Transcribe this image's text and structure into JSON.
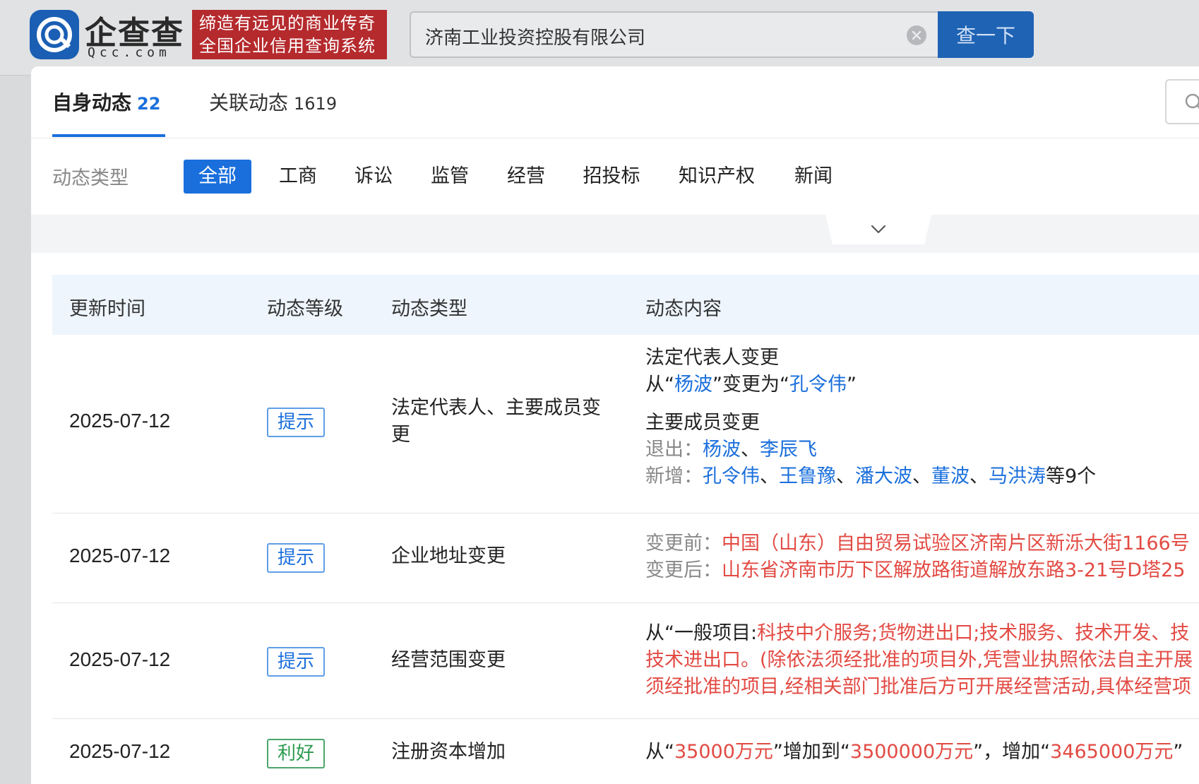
{
  "header": {
    "logo_cn": "企查查",
    "logo_en": "Qcc.com",
    "slogan_line1": "缔造有远见的商业传奇",
    "slogan_line2": "全国企业信用查询系统",
    "search_value": "济南工业投资控股有限公司",
    "search_button": "查一下"
  },
  "tabs": [
    {
      "label": "自身动态",
      "count": "22"
    },
    {
      "label": "关联动态",
      "count": "1619"
    }
  ],
  "filter": {
    "label": "动态类型",
    "chips": [
      "全部",
      "工商",
      "诉讼",
      "监管",
      "经营",
      "招投标",
      "知识产权",
      "新闻"
    ]
  },
  "table": {
    "headers": [
      "更新时间",
      "动态等级",
      "动态类型",
      "动态内容"
    ],
    "rows": [
      {
        "date": "2025-07-12",
        "level": "提示",
        "type": "法定代表人、主要成员变更",
        "content": {
          "legal_title": "法定代表人变更",
          "legal_prefix": "从“",
          "legal_from": "杨波",
          "legal_middle": "”变更为“",
          "legal_to": "孔令伟",
          "legal_suffix": "”",
          "members_title": "主要成员变更",
          "exit_label": "退出：",
          "exit_names": [
            "杨波",
            "李辰飞"
          ],
          "add_label": "新增：",
          "add_names": [
            "孔令伟",
            "王鲁豫",
            "潘大波",
            "董波",
            "马洪涛"
          ],
          "add_suffix": "等9个",
          "sep": "、"
        }
      },
      {
        "date": "2025-07-12",
        "level": "提示",
        "type": "企业地址变更",
        "content": {
          "before_label": "变更前：",
          "before_value": "中国（山东）自由贸易试验区济南片区新泺大街1166号",
          "after_label": "变更后：",
          "after_value": "山东省济南市历下区解放路街道解放东路3-21号D塔25"
        }
      },
      {
        "date": "2025-07-12",
        "level": "提示",
        "type": "经营范围变更",
        "content": {
          "prefix": "从“一般项目:",
          "line1": "科技中介服务;货物进出口;技术服务、技术开发、技",
          "line2": "技术进出口。(除依法须经批准的项目外,凭营业执照依法自主开展",
          "line3": "须经批准的项目,经相关部门批准后方可开展经营活动,具体经营项"
        }
      },
      {
        "date": "2025-07-12",
        "level": "利好",
        "type": "注册资本增加",
        "content": {
          "p1": "从“",
          "from": "35000万元",
          "p2": "”增加到“",
          "to": "3500000万元",
          "p3": "”，增加“",
          "delta": "3465000万元",
          "p4": "”"
        }
      }
    ]
  }
}
